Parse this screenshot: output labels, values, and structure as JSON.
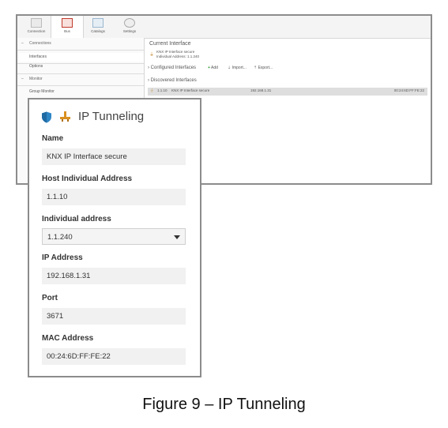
{
  "toolbar": {
    "items": [
      {
        "label": "Connection",
        "icon": "connection-icon"
      },
      {
        "label": "Bus",
        "icon": "bus-icon"
      },
      {
        "label": "Catalogs",
        "icon": "catalogs-icon"
      },
      {
        "label": "Settings",
        "icon": "settings-icon"
      }
    ]
  },
  "sidebar": {
    "group_connections": "Connections",
    "interfaces": "Interfaces",
    "options": "Options",
    "group_monitor": "Monitor",
    "group_monitor_item": "Group Monitor"
  },
  "main": {
    "current_interface_heading": "Current Interface",
    "current_interface_name": "KNX IP Interface secure",
    "current_interface_address": "Individual Address: 1.1.240",
    "configured_interfaces": "Configured Interfaces",
    "add_label": "Add",
    "import_label": "Import...",
    "export_label": "Export...",
    "discovered_interfaces": "Discovered Interfaces",
    "discovered_row": {
      "address": "1.1.10",
      "name": "KNX IP Interface secure",
      "ip": "192.168.1.31",
      "mac": "00:24:6D:FF:FE:22"
    }
  },
  "panel": {
    "title": "IP Tunneling",
    "fields": {
      "name_label": "Name",
      "name_value": "KNX IP Interface secure",
      "host_label": "Host Individual Address",
      "host_value": "1.1.10",
      "individual_label": "Individual address",
      "individual_value": "1.1.240",
      "ip_label": "IP Address",
      "ip_value": "192.168.1.31",
      "port_label": "Port",
      "port_value": "3671",
      "mac_label": "MAC Address",
      "mac_value": "00:24:6D:FF:FE:22"
    }
  },
  "caption": "Figure 9 – IP Tunneling",
  "colors": {
    "shield": "#2f86c5",
    "plug": "#d99020",
    "add_plus": "#2e9a2e",
    "bus_icon": "#c0392b",
    "frame_border": "#8c8c8c"
  }
}
